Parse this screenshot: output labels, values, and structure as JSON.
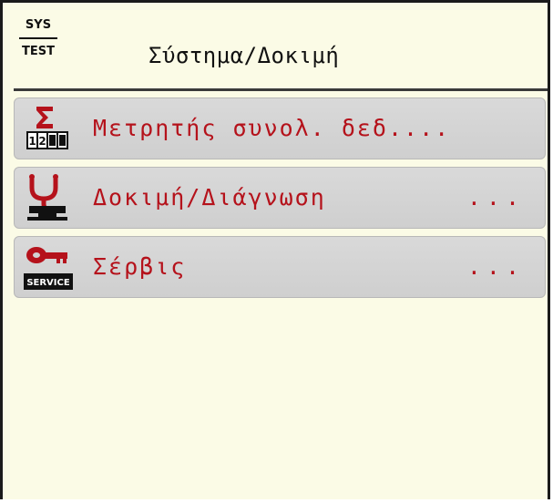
{
  "header": {
    "badge_top": "SYS",
    "badge_bottom": "TEST",
    "title": "Σύστημα/Δοκιμή"
  },
  "menu": {
    "items": [
      {
        "label": "Μετρητής συνολ. δεδ....",
        "more": "",
        "icon": "counter-sum-icon"
      },
      {
        "label": "Δοκιμή/Διάγνωση",
        "more": "...",
        "icon": "diagnosis-stethoscope-icon"
      },
      {
        "label": "Σέρβις",
        "more": "...",
        "icon": "service-key-icon"
      }
    ]
  },
  "colors": {
    "background": "#fbfbe6",
    "item_background": "#d3d3d3",
    "accent_red": "#b5121b",
    "text_dark": "#111111"
  }
}
